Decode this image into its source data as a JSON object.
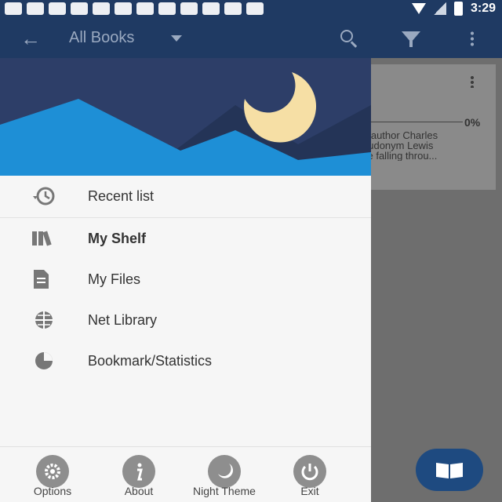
{
  "status_bar": {
    "time": "3:29",
    "notification_icons": [
      "dots-icon",
      "facebook-icon",
      "b-icon",
      "ghost-icon",
      "shop-icon",
      "cat-icon",
      "linkedin-icon",
      "facebook-icon",
      "cat-icon",
      "esc-icon",
      "pinterest-icon",
      "cat-icon"
    ]
  },
  "app_bar": {
    "title": "All Books",
    "back_icon": "arrow-left-icon",
    "search_icon": "search-icon",
    "filter_icon": "filter-icon",
    "more_icon": "more-vert-icon"
  },
  "book_card": {
    "progress": "0%",
    "description": "n author Charles\neudonym Lewis\nce falling throu..."
  },
  "drawer": {
    "menu": [
      {
        "label": "Recent list",
        "icon": "history-icon"
      },
      {
        "label": "My Shelf",
        "icon": "shelf-icon",
        "selected": true
      },
      {
        "label": "My Files",
        "icon": "file-icon"
      },
      {
        "label": "Net Library",
        "icon": "globe-icon"
      },
      {
        "label": "Bookmark/Statistics",
        "icon": "pie-chart-icon"
      }
    ],
    "footer": [
      {
        "label": "Options",
        "icon": "gear-icon"
      },
      {
        "label": "About",
        "icon": "info-icon"
      },
      {
        "label": "Night Theme",
        "icon": "moon-icon"
      },
      {
        "label": "Exit",
        "icon": "power-icon"
      }
    ]
  },
  "colors": {
    "app_bar": "#1f3a63",
    "header_sky": "#2d3e68",
    "header_mountain_light": "#1e8fd6",
    "header_mountain_dark": "#243457",
    "moon": "#f6dfa5",
    "fab": "#1e4a80"
  }
}
